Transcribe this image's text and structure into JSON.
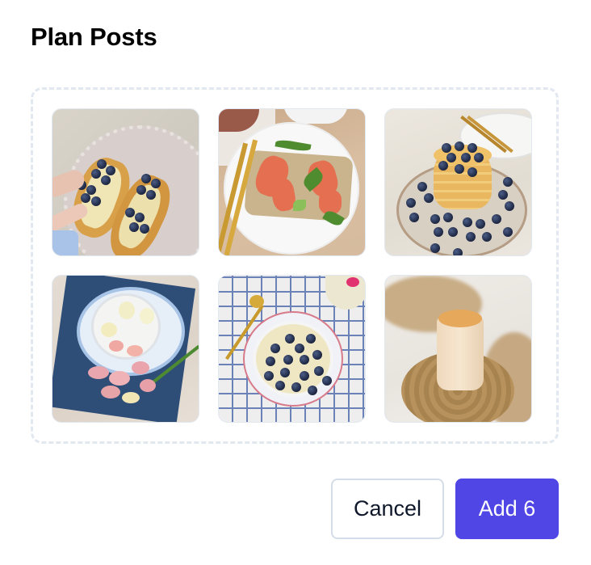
{
  "dialog": {
    "title": "Plan Posts"
  },
  "posts": [
    {
      "id": 1,
      "subject": "croissant toast with blueberries and cream on beaded plate",
      "icon": "image-thumbnail"
    },
    {
      "id": 2,
      "subject": "salmon avocado toast with greens and gold fork",
      "icon": "image-thumbnail"
    },
    {
      "id": 3,
      "subject": "pancake stack with blueberries",
      "icon": "image-thumbnail"
    },
    {
      "id": 4,
      "subject": "tea cup with flowers on blue napkin",
      "icon": "image-thumbnail"
    },
    {
      "id": 5,
      "subject": "custard bowl with blueberries and gold spoon",
      "icon": "image-thumbnail"
    },
    {
      "id": 6,
      "subject": "iced latte with crumble on wood slice with pampas grass",
      "icon": "image-thumbnail"
    }
  ],
  "actions": {
    "cancel_label": "Cancel",
    "add_label": "Add 6"
  },
  "colors": {
    "primary": "#4f46e5",
    "dropzone_border": "#e2e8f0",
    "cancel_border": "#d4dde9",
    "text": "#0f172a"
  }
}
